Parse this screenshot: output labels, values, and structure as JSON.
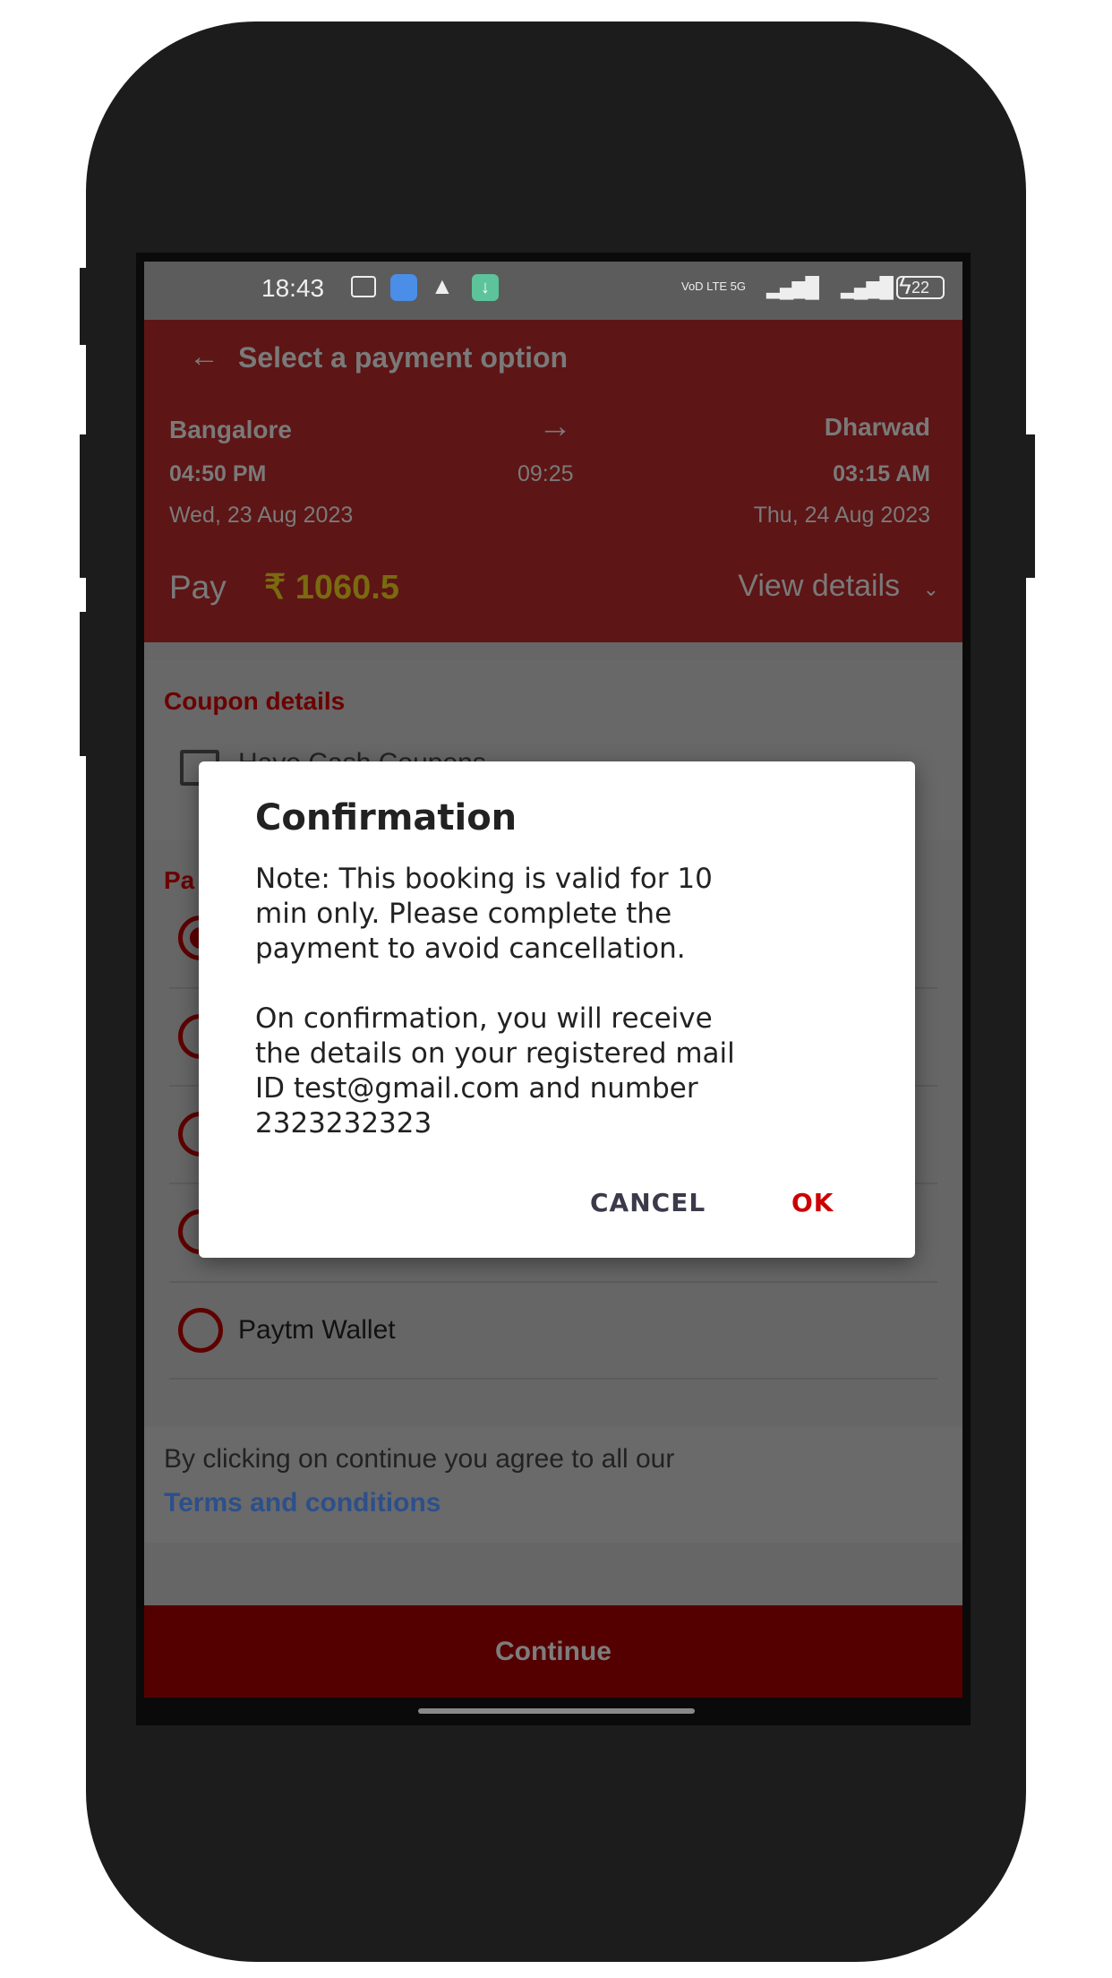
{
  "status_bar": {
    "time": "18:43",
    "network": "VoD LTE 5G",
    "battery": "22",
    "icons": [
      "message-icon",
      "app-icon",
      "warning-icon",
      "download-icon",
      "signal-icon",
      "battery-icon",
      "charging-icon"
    ]
  },
  "header": {
    "title": "Select a payment option",
    "from": "Bangalore",
    "to": "Dharwad",
    "depart_time": "04:50 PM",
    "duration": "09:25",
    "arrive_time": "03:15 AM",
    "depart_date": "Wed, 23 Aug 2023",
    "arrive_date": "Thu, 24 Aug 2023",
    "pay_label": "Pay",
    "amount": "₹ 1060.5",
    "view_details": "View details"
  },
  "coupon": {
    "title": "Coupon details",
    "checkbox_label": "Have Cash Coupons"
  },
  "payment": {
    "title_visible": "Pa",
    "options": [
      {
        "label": "",
        "selected": true
      },
      {
        "label": "",
        "selected": false
      },
      {
        "label": "",
        "selected": false
      },
      {
        "label": "",
        "selected": false
      },
      {
        "label": "Paytm Wallet",
        "selected": false
      }
    ]
  },
  "terms": {
    "text": "By clicking on continue you agree to all our",
    "link": "Terms and conditions"
  },
  "continue_label": "Continue",
  "dialog": {
    "title": "Confirmation",
    "body": "Note: This booking is valid for 10\nmin only. Please complete the\npayment to avoid cancellation.\n\nOn confirmation, you will receive\nthe details on your registered mail\nID test@gmail.com and number\n2323232323",
    "cancel": "CANCEL",
    "ok": "OK"
  },
  "colors": {
    "header": "#5e1515",
    "accent": "#cc0000",
    "continue": "#550000",
    "link": "#2d4f8a",
    "amount": "#7a6a10"
  }
}
